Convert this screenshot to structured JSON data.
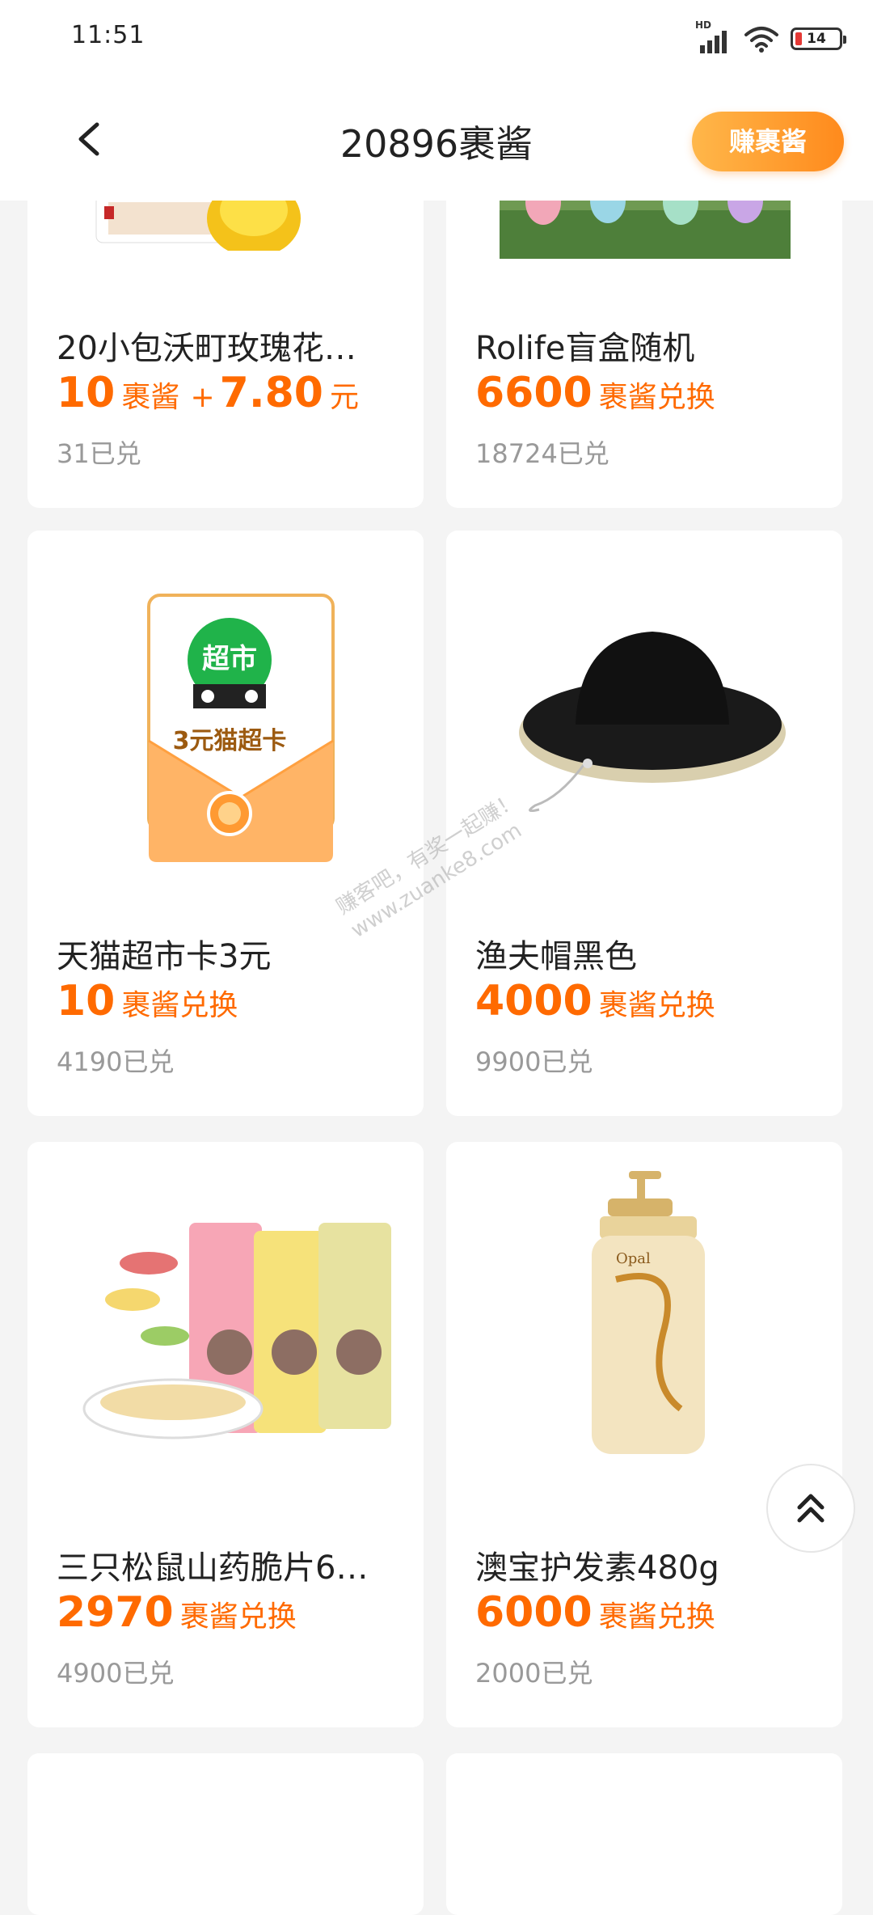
{
  "status_bar": {
    "time": "11:51",
    "network": "HD",
    "battery": "14"
  },
  "header": {
    "title": "20896裹酱",
    "earn_button": "赚裹酱"
  },
  "products": [
    {
      "name": "20小包沃町玫瑰花…",
      "points": "10",
      "points_unit": "裹酱",
      "plus": "+",
      "cash": "7.80",
      "cash_unit": "元",
      "sold": "31已兑",
      "image": "rose-tea-pack-image"
    },
    {
      "name": "Rolife盲盒随机",
      "points": "6600",
      "unit": "裹酱兑换",
      "sold": "18724已兑",
      "image": "blind-box-figures-image"
    },
    {
      "name": "天猫超市卡3元",
      "points": "10",
      "unit": "裹酱兑换",
      "sold": "4190已兑",
      "image": "tmall-supermarket-card-image",
      "card_badge": "超市",
      "card_text": "3元猫超卡"
    },
    {
      "name": "渔夫帽黑色",
      "points": "4000",
      "unit": "裹酱兑换",
      "sold": "9900已兑",
      "image": "black-bucket-hat-image"
    },
    {
      "name": "三只松鼠山药脆片6…",
      "points": "2970",
      "unit": "裹酱兑换",
      "sold": "4900已兑",
      "image": "yam-chips-image"
    },
    {
      "name": "澳宝护发素480g",
      "points": "6000",
      "unit": "裹酱兑换",
      "sold": "2000已兑",
      "image": "conditioner-bottle-image",
      "bottle_brand": "Opal"
    }
  ],
  "watermark": {
    "line1": "赚客吧，有奖一起赚！",
    "line2": "www.zuanke8.com"
  },
  "colors": {
    "accent": "#ff6a00",
    "button_start": "#ffb74a",
    "button_end": "#ff8a1c"
  }
}
